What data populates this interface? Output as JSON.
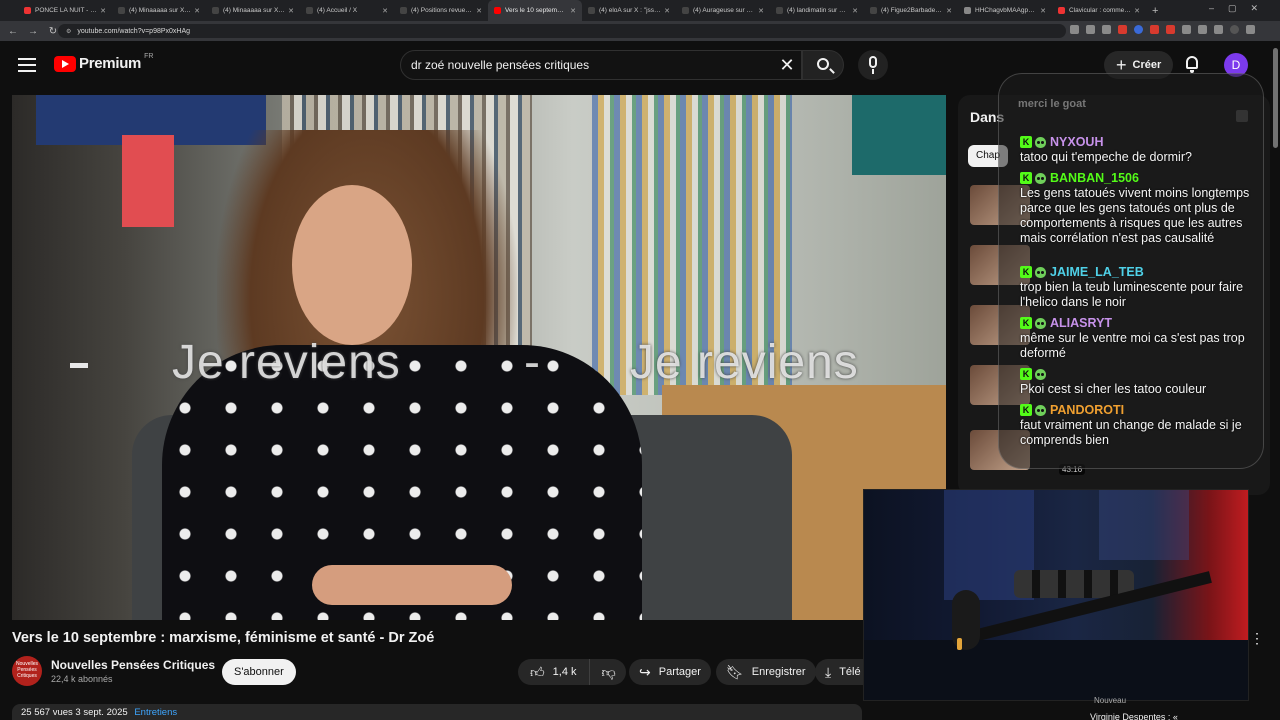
{
  "browser": {
    "tabs": [
      {
        "title": "PONCE LA NUIT - SAIS",
        "fav": "#e33"
      },
      {
        "title": "(4) Minaaaaa sur X : \"|",
        "fav": "#444"
      },
      {
        "title": "(4) Minaaaaa sur X : \"u",
        "fav": "#444"
      },
      {
        "title": "(4) Accueil / X",
        "fav": "#444"
      },
      {
        "title": "(4) Positions revue (@",
        "fav": "#444"
      },
      {
        "title": "Vers le 10 septembre :",
        "fav": "#f00",
        "active": true
      },
      {
        "title": "(4) eloA sur X : \"jss ren",
        "fav": "#444"
      },
      {
        "title": "(4) Aurageuse sur X : \"",
        "fav": "#444"
      },
      {
        "title": "(4) landimatin sur X : \"",
        "fav": "#444"
      },
      {
        "title": "(4) Figue2Barbade sur X",
        "fav": "#444"
      },
      {
        "title": "HHChagvbMAAgpoc.jp",
        "fav": "#888"
      },
      {
        "title": "Clavicular : comment ur",
        "fav": "#e33"
      }
    ],
    "url": "youtube.com/watch?v=p98Px0xHAg"
  },
  "header": {
    "logo_text": "Premium",
    "country_code": "FR",
    "search_query": "dr zoé nouvelle pensées critiques",
    "create_label": "Créer",
    "avatar_letter": "D"
  },
  "video": {
    "overlay_text_left": "Je reviens",
    "overlay_dash": "-",
    "overlay_text_right": "Je reviens",
    "title": "Vers le 10 septembre : marxisme, féminisme et santé - Dr Zoé",
    "channel_name": "Nouvelles Pensées Critiques",
    "channel_avatar_text": "Nouvelles Pensées Critiques",
    "subscribers": "22,4 k abonnés",
    "subscribe_label": "S'abonner",
    "likes": "1,4 k",
    "share_label": "Partager",
    "save_label": "Enregistrer",
    "download_label": "Télé",
    "views": "25 567 vues",
    "date": "3 sept. 2025",
    "tag": "Entretiens"
  },
  "side_panel": {
    "title": "Dans",
    "chip": "Chap",
    "timestamp": "43:16",
    "nouveau": "Nouveau",
    "next_title": "Virginie Despentes : «"
  },
  "chat": {
    "faded_line": "merci le goat",
    "messages": [
      {
        "user": "NYXOUH",
        "color": "#c792ea",
        "text": "tatoo qui t'empeche de dormir?"
      },
      {
        "user": "BANBAN_1506",
        "color": "#53fc18",
        "text": "Les gens tatoués vivent moins longtemps parce que les gens tatoués ont plus de comportements à risques que les autres mais corrélation n'est pas causalité"
      },
      {
        "user": "JAIME_LA_TEB",
        "color": "#4fd1e8",
        "text": "trop bien la teub luminescente pour faire l'helico dans le noir"
      },
      {
        "user": "ALIASRYT",
        "color": "#c792ea",
        "text": "même sur le ventre moi ca s'est pas trop deformé"
      },
      {
        "user": "",
        "color": "#3a6ad8",
        "text": "Pkoi cest si cher les tatoo couleur"
      },
      {
        "user": "PANDOROTI",
        "color": "#f0a030",
        "text": "faut vraiment un change de malade si je comprends bien"
      }
    ]
  }
}
